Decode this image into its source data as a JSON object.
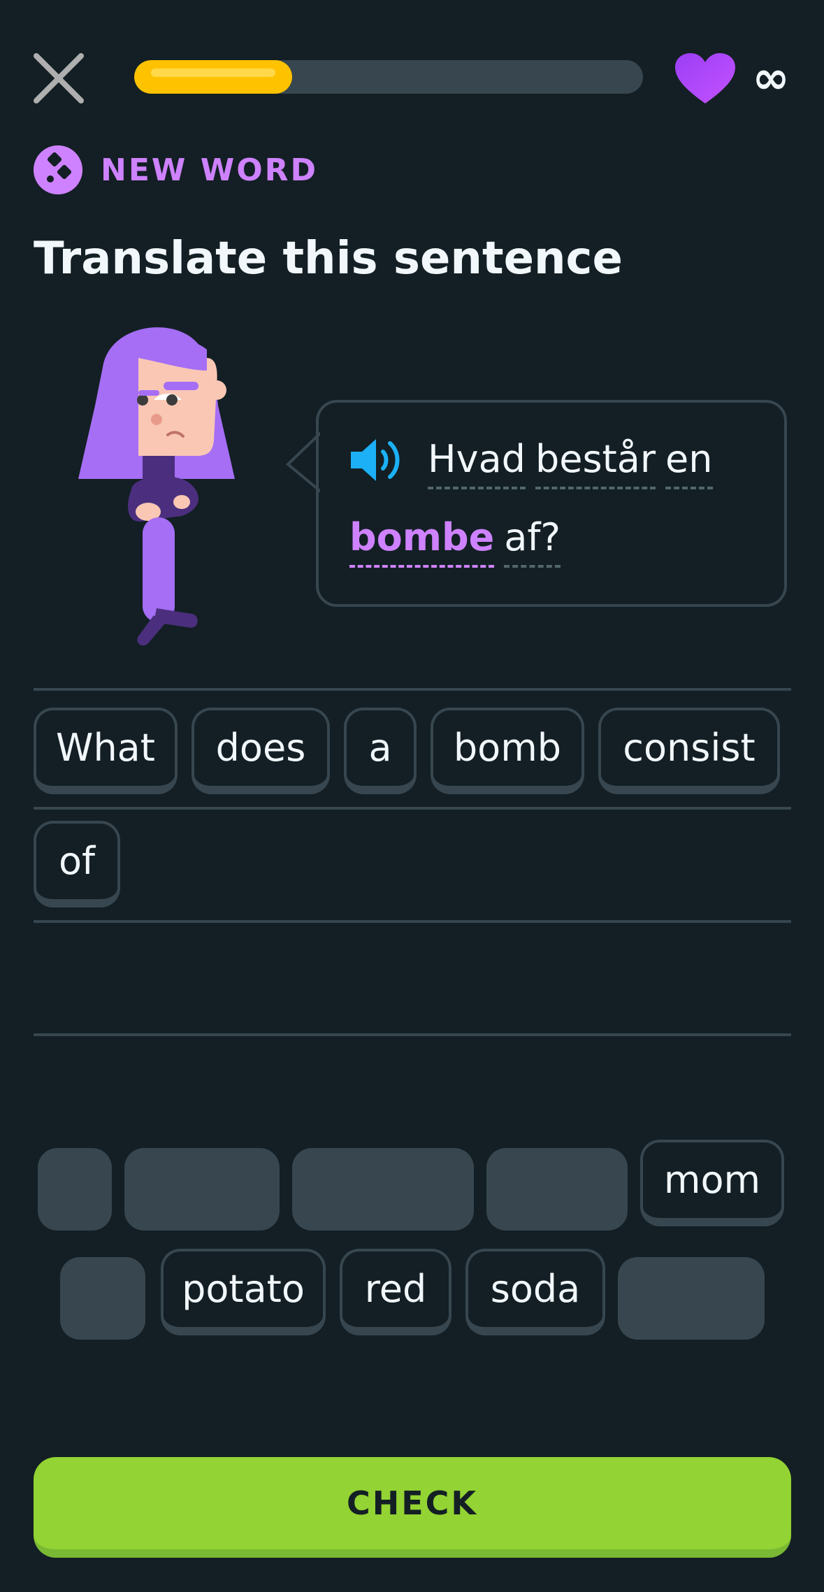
{
  "header": {
    "close_icon": "close-icon",
    "progress": 0.31,
    "heart_icon": "heart-icon",
    "hearts_value": "∞"
  },
  "badge": {
    "icon": "new-word-icon",
    "label": "NEW WORD"
  },
  "title": "Translate this sentence",
  "prompt": {
    "speaker_icon": "speaker-icon",
    "line1": [
      "Hvad",
      "består",
      "en"
    ],
    "line2_highlight": "bombe",
    "line2_rest": "af?"
  },
  "answer": {
    "selected_words": [
      "What",
      "does",
      "a",
      "bomb",
      "consist",
      "of"
    ]
  },
  "word_bank": {
    "row1_word": "mom",
    "row2_words": [
      "potato",
      "red",
      "soda"
    ]
  },
  "check_button": "CHECK",
  "colors": {
    "background": "#131f24",
    "progress": "#ffc200",
    "highlight": "#ce82ff",
    "check": "#93d333"
  }
}
